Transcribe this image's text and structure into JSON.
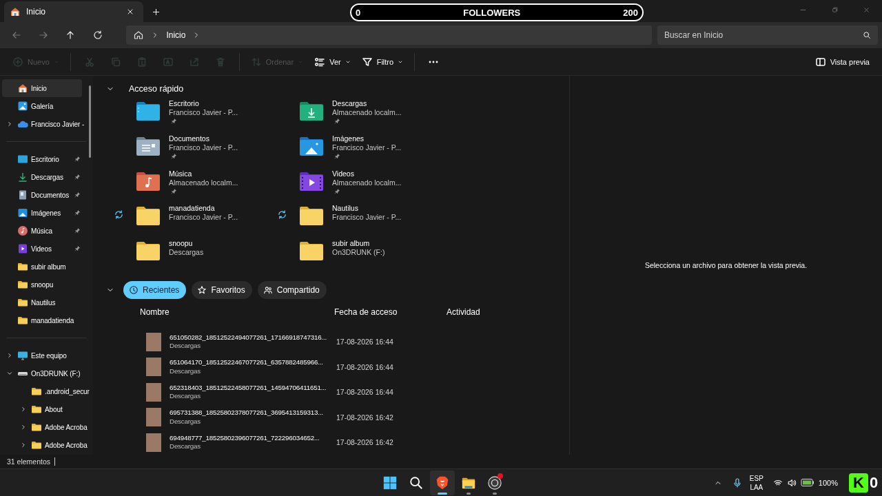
{
  "window": {
    "tab": {
      "title": "Inicio",
      "selected": true
    }
  },
  "followers_overlay": {
    "start": "0",
    "label": "FOLLOWERS",
    "goal": "200",
    "level": 0
  },
  "address_bar": {
    "breadcrumb": [
      "Inicio"
    ],
    "search": {
      "placeholder": "Buscar en Inicio"
    }
  },
  "toolbar": {
    "items": [
      {
        "kind": "new",
        "label": "Nuevo",
        "disabled": true,
        "dropdown": true
      },
      {
        "kind": "separator"
      },
      {
        "kind": "cut",
        "disabled": true
      },
      {
        "kind": "copy",
        "disabled": true
      },
      {
        "kind": "paste",
        "disabled": true
      },
      {
        "kind": "rename",
        "disabled": true
      },
      {
        "kind": "share",
        "disabled": true
      },
      {
        "kind": "delete",
        "disabled": true
      },
      {
        "kind": "separator"
      },
      {
        "kind": "sort",
        "label": "Ordenar",
        "disabled": true,
        "dropdown": true
      },
      {
        "kind": "view",
        "label": "Ver",
        "disabled": false,
        "dropdown": true
      },
      {
        "kind": "filter",
        "label": "Filtro",
        "disabled": false,
        "dropdown": true
      },
      {
        "kind": "separator"
      },
      {
        "kind": "more",
        "disabled": false
      }
    ],
    "preview_toggle": {
      "label": "Vista previa"
    }
  },
  "sidebar": {
    "sections": [
      {
        "items": [
          {
            "label": "Inicio",
            "kind": "home",
            "selected": true
          },
          {
            "label": "Galería",
            "kind": "gallery",
            "selected": false
          },
          {
            "label": "Francisco Javier -",
            "kind": "cloud",
            "selected": false,
            "expanded": false
          }
        ]
      },
      {
        "items": [
          {
            "label": "Escritorio",
            "kind": "desktop",
            "selected": false,
            "pinned": true
          },
          {
            "label": "Descargas",
            "kind": "download",
            "selected": false,
            "pinned": true
          },
          {
            "label": "Documentos",
            "kind": "documents",
            "selected": false,
            "pinned": true
          },
          {
            "label": "Imágenes",
            "kind": "pictures",
            "selected": false,
            "pinned": true
          },
          {
            "label": "Música",
            "kind": "music",
            "selected": false,
            "pinned": true
          },
          {
            "label": "Videos",
            "kind": "videos",
            "selected": false,
            "pinned": true
          },
          {
            "label": "subir album",
            "kind": "folder",
            "selected": false
          },
          {
            "label": "snoopu",
            "kind": "folder",
            "selected": false
          },
          {
            "label": "Nautilus",
            "kind": "folder",
            "selected": false
          },
          {
            "label": "manadatienda",
            "kind": "folder",
            "selected": false
          }
        ]
      },
      {
        "items": [
          {
            "label": "Este equipo",
            "kind": "pc",
            "selected": false,
            "expanded": false
          },
          {
            "label": "On3DRUNK (F:)",
            "kind": "drive",
            "selected": false,
            "expanded": true,
            "children": [
              {
                "label": ".android_secur",
                "kind": "folder",
                "selected": false
              },
              {
                "label": "About",
                "kind": "folder",
                "selected": false,
                "expanded": false
              },
              {
                "label": "Adobe Acroba",
                "kind": "folder",
                "selected": false,
                "expanded": false
              },
              {
                "label": "Adobe Acroba",
                "kind": "folder",
                "selected": false,
                "expanded": false
              }
            ]
          }
        ]
      }
    ]
  },
  "quick_access": {
    "title": "Acceso rápido",
    "expanded": true,
    "items": [
      {
        "name": "Escritorio",
        "location": "Francisco Javier - P...",
        "kind": "desktop",
        "pinned": true,
        "syncing": false
      },
      {
        "name": "Descargas",
        "location": "Almacenado localm...",
        "kind": "download",
        "pinned": true,
        "syncing": false
      },
      {
        "name": "Documentos",
        "location": "Francisco Javier - P...",
        "kind": "documents",
        "pinned": true,
        "syncing": false
      },
      {
        "name": "Imágenes",
        "location": "Francisco Javier - P...",
        "kind": "pictures",
        "pinned": true,
        "syncing": false
      },
      {
        "name": "Música",
        "location": "Almacenado localm...",
        "kind": "music",
        "pinned": true,
        "syncing": false
      },
      {
        "name": "Videos",
        "location": "Almacenado localm...",
        "kind": "videos",
        "pinned": true,
        "syncing": false
      },
      {
        "name": "manadatienda",
        "location": "Francisco Javier - P...",
        "kind": "folder",
        "pinned": false,
        "syncing": true
      },
      {
        "name": "Nautilus",
        "location": "Francisco Javier - P...",
        "kind": "folder",
        "pinned": false,
        "syncing": true
      },
      {
        "name": "snoopu",
        "location": "Descargas",
        "kind": "folder",
        "pinned": false,
        "syncing": false
      },
      {
        "name": "subir album",
        "location": "On3DRUNK (F:)",
        "kind": "folder",
        "pinned": false,
        "syncing": false
      }
    ]
  },
  "recent": {
    "expanded": true,
    "tabs": [
      {
        "label": "Recientes",
        "kind": "clock",
        "selected": true
      },
      {
        "label": "Favoritos",
        "kind": "star",
        "selected": false
      },
      {
        "label": "Compartido",
        "kind": "people",
        "selected": false
      }
    ],
    "columns": [
      "Nombre",
      "Fecha de acceso",
      "Actividad"
    ],
    "rows": [
      {
        "name": "651050282_18512522494077261_17166918747316...",
        "location": "Descargas",
        "date": "17-08-2026 16:44"
      },
      {
        "name": "651064170_18512522467077261_6357882485966...",
        "location": "Descargas",
        "date": "17-08-2026 16:44"
      },
      {
        "name": "652318403_18512522458077261_14594706411651...",
        "location": "Descargas",
        "date": "17-08-2026 16:44"
      },
      {
        "name": "695731388_18525802378077261_3695413159313...",
        "location": "Descargas",
        "date": "17-08-2026 16:42"
      },
      {
        "name": "694948777_18525802396077261_722296034652...",
        "location": "Descargas",
        "date": "17-08-2026 16:42"
      }
    ]
  },
  "preview": {
    "message": "Selecciona un archivo para obtener la vista previa."
  },
  "status_bar": {
    "count": "31 elementos"
  },
  "taskbar": {
    "apps": [
      {
        "kind": "start",
        "selected": false,
        "running": false,
        "badge": false
      },
      {
        "kind": "search",
        "selected": false,
        "running": false,
        "badge": false
      },
      {
        "kind": "browser",
        "selected": true,
        "running": true,
        "badge": false
      },
      {
        "kind": "explorer",
        "selected": false,
        "running": true,
        "badge": false
      },
      {
        "kind": "recorder",
        "selected": false,
        "running": true,
        "badge": true
      }
    ],
    "tray": {
      "language": "ESP",
      "layout": "LAA",
      "battery": "100%"
    },
    "stream_overlay": {
      "logo": "K",
      "count": "0"
    }
  }
}
